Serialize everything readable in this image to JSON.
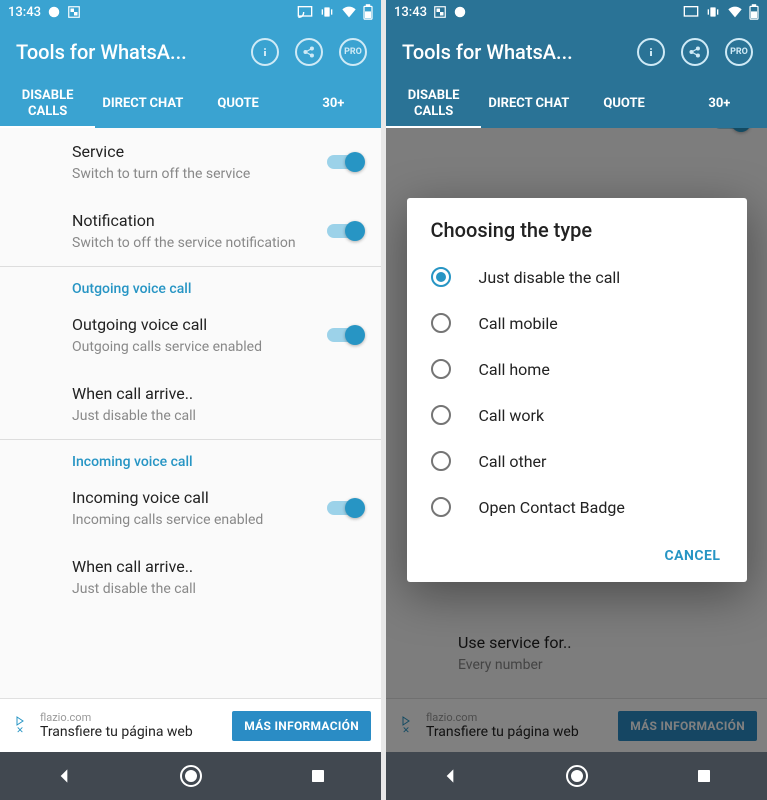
{
  "status": {
    "time": "13:43"
  },
  "appbar": {
    "title": "Tools for WhatsA...",
    "pro": "PRO"
  },
  "tabs": {
    "t0": "DISABLE CALLS",
    "t1": "DIRECT CHAT",
    "t2": "QUOTE",
    "t3": "30+"
  },
  "settings": {
    "service": {
      "title": "Service",
      "sub": "Switch to turn off the service"
    },
    "notification": {
      "title": "Notification",
      "sub": "Switch to off the service notification"
    },
    "outgoing_header": "Outgoing voice call",
    "outgoing": {
      "title": "Outgoing voice call",
      "sub": "Outgoing calls service enabled"
    },
    "when_out": {
      "title": "When call arrive..",
      "sub": "Just disable the call"
    },
    "incoming_header": "Incoming voice call",
    "incoming": {
      "title": "Incoming voice call",
      "sub": "Incoming calls service enabled"
    },
    "when_in": {
      "title": "When call arrive..",
      "sub": "Just disable the call"
    },
    "use_for": {
      "title": "Use service for..",
      "sub": "Every number"
    }
  },
  "ad": {
    "host": "flazio.com",
    "title": "Transfiere tu página web",
    "cta": "MÁS INFORMACIÓN"
  },
  "dialog": {
    "title": "Choosing the type",
    "options": {
      "o0": "Just disable the call",
      "o1": "Call mobile",
      "o2": "Call home",
      "o3": "Call work",
      "o4": "Call other",
      "o5": "Open Contact Badge"
    },
    "cancel": "CANCEL"
  }
}
